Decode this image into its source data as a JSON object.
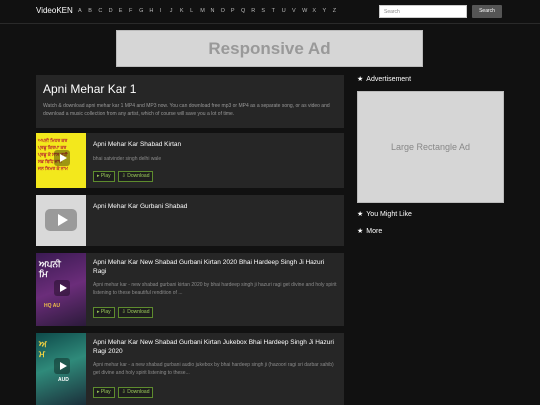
{
  "header": {
    "brand": "VideoKEN",
    "letters": [
      "A",
      "B",
      "C",
      "D",
      "E",
      "F",
      "G",
      "H",
      "I",
      "J",
      "K",
      "L",
      "M",
      "N",
      "O",
      "P",
      "Q",
      "R",
      "S",
      "T",
      "U",
      "V",
      "W",
      "X",
      "Y",
      "Z"
    ],
    "search_placeholder": "Search",
    "search_button": "Search"
  },
  "banner": {
    "text": "Responsive Ad"
  },
  "hero": {
    "title": "Apni Mehar Kar 1",
    "description": "Watch & download apni mehar kar 1 MP4 and MP3 now. You can download free mp3 or MP4 as a separate song, or as video and download a music collection from any artist, which of course will save you a lot of time."
  },
  "results": [
    {
      "title": "Apni Mehar Kar Shabad Kirtan",
      "desc": "bhai satvinder singh delhi wale",
      "play": "Play",
      "download": "Download",
      "thumb": "gurmukhi-text-yellow"
    },
    {
      "title": "Apni Mehar Kar Gurbani Shabad",
      "desc": "",
      "play": "",
      "download": "",
      "thumb": "grey-placeholder"
    },
    {
      "title": "Apni Mehar Kar New Shabad Gurbani Kirtan 2020 Bhai Hardeep Singh Ji Hazuri Ragi",
      "desc": "Apni mehar kar - new shabad gurbani kirtan 2020 by bhai hardeep singh ji hazuri ragi get divine and holy spirit listening to these beautiful rendition of ...",
      "play": "Play",
      "download": "Download",
      "thumb": "purple-poster"
    },
    {
      "title": "Apni Mehar Kar New Shabad Gurbani Kirtan Jukebox Bhai Hardeep Singh Ji Hazuri Ragi 2020",
      "desc": "Apni mehar kar - a new shabad gurbani audio jukebox by bhai hardeep singh ji (hazoori ragi sri darbar sahib) get divine and holy spirit listening to these...",
      "play": "Play",
      "download": "Download",
      "thumb": "teal-poster"
    }
  ],
  "sidebar": {
    "advertisement": "Advertisement",
    "rect_ad": "Large Rectangle Ad",
    "you_might_like": "You Might Like",
    "more": "More"
  },
  "colors": {
    "background": "#111111",
    "card": "#262626",
    "button_green": "#9ccc5a"
  }
}
